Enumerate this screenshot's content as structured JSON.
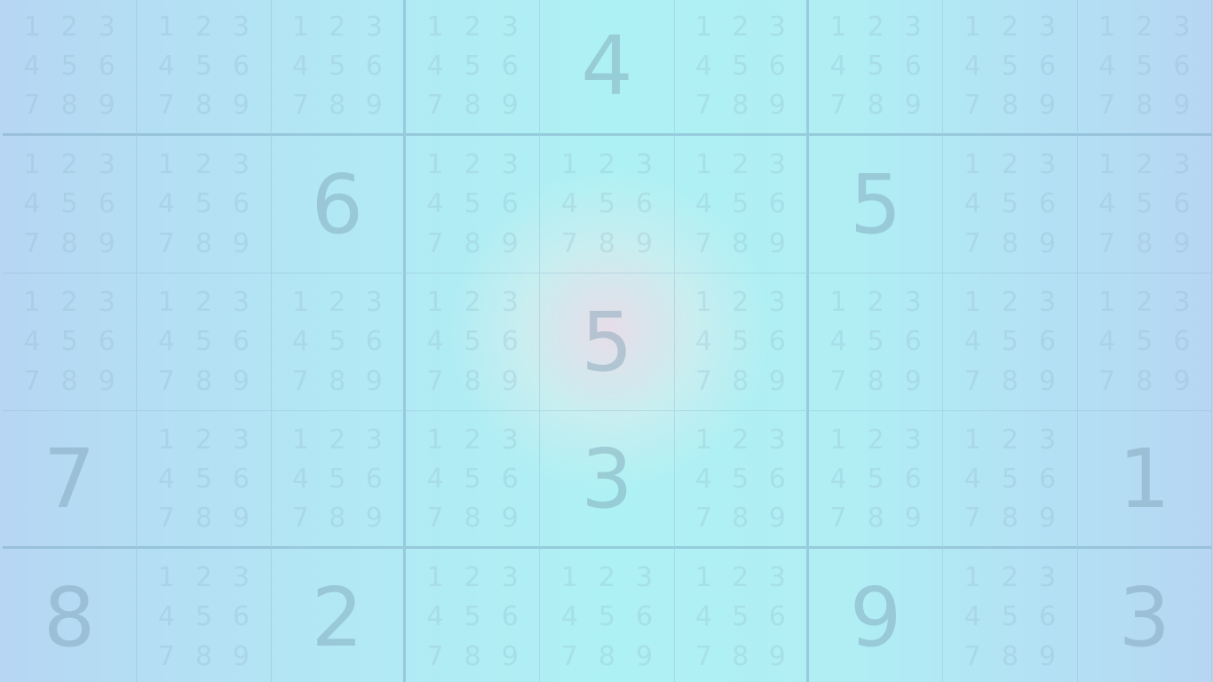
{
  "board": {
    "rows": [
      [
        null,
        null,
        null,
        null,
        "4",
        null,
        null,
        null,
        null
      ],
      [
        null,
        null,
        "6",
        null,
        null,
        null,
        "5",
        null,
        null
      ],
      [
        null,
        null,
        null,
        null,
        "5",
        null,
        null,
        null,
        null
      ],
      [
        "7",
        null,
        null,
        null,
        "3",
        null,
        null,
        null,
        "1"
      ],
      [
        "8",
        null,
        "2",
        null,
        null,
        null,
        "9",
        null,
        "3"
      ]
    ],
    "pencil_marks": [
      "1",
      "2",
      "3",
      "4",
      "5",
      "6",
      "7",
      "8",
      "9"
    ],
    "selected_cell": {
      "row": 3,
      "col": 5
    },
    "colors": {
      "given_digit": "#7a9baf",
      "selected_highlight": "#e7dde9",
      "background_edge": "#b6d6f3",
      "background_center": "#aef1f4"
    }
  }
}
